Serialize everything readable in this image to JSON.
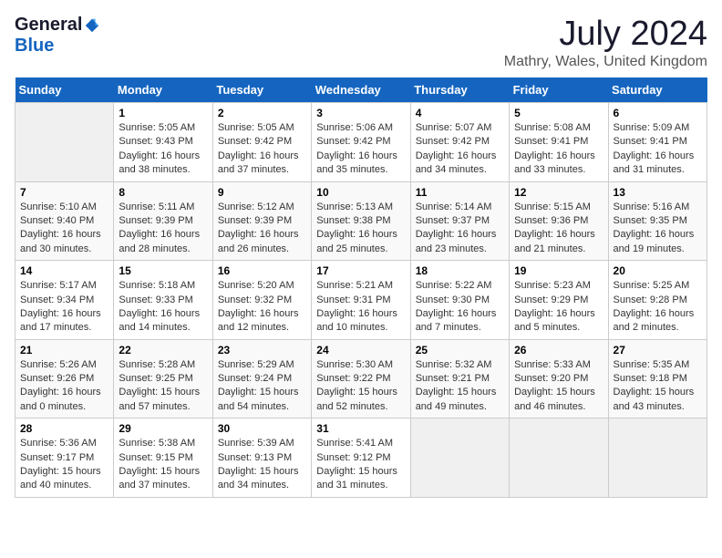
{
  "logo": {
    "general": "General",
    "blue": "Blue"
  },
  "title": "July 2024",
  "subtitle": "Mathry, Wales, United Kingdom",
  "headers": [
    "Sunday",
    "Monday",
    "Tuesday",
    "Wednesday",
    "Thursday",
    "Friday",
    "Saturday"
  ],
  "weeks": [
    [
      {
        "day": "",
        "info": ""
      },
      {
        "day": "1",
        "info": "Sunrise: 5:05 AM\nSunset: 9:43 PM\nDaylight: 16 hours\nand 38 minutes."
      },
      {
        "day": "2",
        "info": "Sunrise: 5:05 AM\nSunset: 9:42 PM\nDaylight: 16 hours\nand 37 minutes."
      },
      {
        "day": "3",
        "info": "Sunrise: 5:06 AM\nSunset: 9:42 PM\nDaylight: 16 hours\nand 35 minutes."
      },
      {
        "day": "4",
        "info": "Sunrise: 5:07 AM\nSunset: 9:42 PM\nDaylight: 16 hours\nand 34 minutes."
      },
      {
        "day": "5",
        "info": "Sunrise: 5:08 AM\nSunset: 9:41 PM\nDaylight: 16 hours\nand 33 minutes."
      },
      {
        "day": "6",
        "info": "Sunrise: 5:09 AM\nSunset: 9:41 PM\nDaylight: 16 hours\nand 31 minutes."
      }
    ],
    [
      {
        "day": "7",
        "info": "Sunrise: 5:10 AM\nSunset: 9:40 PM\nDaylight: 16 hours\nand 30 minutes."
      },
      {
        "day": "8",
        "info": "Sunrise: 5:11 AM\nSunset: 9:39 PM\nDaylight: 16 hours\nand 28 minutes."
      },
      {
        "day": "9",
        "info": "Sunrise: 5:12 AM\nSunset: 9:39 PM\nDaylight: 16 hours\nand 26 minutes."
      },
      {
        "day": "10",
        "info": "Sunrise: 5:13 AM\nSunset: 9:38 PM\nDaylight: 16 hours\nand 25 minutes."
      },
      {
        "day": "11",
        "info": "Sunrise: 5:14 AM\nSunset: 9:37 PM\nDaylight: 16 hours\nand 23 minutes."
      },
      {
        "day": "12",
        "info": "Sunrise: 5:15 AM\nSunset: 9:36 PM\nDaylight: 16 hours\nand 21 minutes."
      },
      {
        "day": "13",
        "info": "Sunrise: 5:16 AM\nSunset: 9:35 PM\nDaylight: 16 hours\nand 19 minutes."
      }
    ],
    [
      {
        "day": "14",
        "info": "Sunrise: 5:17 AM\nSunset: 9:34 PM\nDaylight: 16 hours\nand 17 minutes."
      },
      {
        "day": "15",
        "info": "Sunrise: 5:18 AM\nSunset: 9:33 PM\nDaylight: 16 hours\nand 14 minutes."
      },
      {
        "day": "16",
        "info": "Sunrise: 5:20 AM\nSunset: 9:32 PM\nDaylight: 16 hours\nand 12 minutes."
      },
      {
        "day": "17",
        "info": "Sunrise: 5:21 AM\nSunset: 9:31 PM\nDaylight: 16 hours\nand 10 minutes."
      },
      {
        "day": "18",
        "info": "Sunrise: 5:22 AM\nSunset: 9:30 PM\nDaylight: 16 hours\nand 7 minutes."
      },
      {
        "day": "19",
        "info": "Sunrise: 5:23 AM\nSunset: 9:29 PM\nDaylight: 16 hours\nand 5 minutes."
      },
      {
        "day": "20",
        "info": "Sunrise: 5:25 AM\nSunset: 9:28 PM\nDaylight: 16 hours\nand 2 minutes."
      }
    ],
    [
      {
        "day": "21",
        "info": "Sunrise: 5:26 AM\nSunset: 9:26 PM\nDaylight: 16 hours\nand 0 minutes."
      },
      {
        "day": "22",
        "info": "Sunrise: 5:28 AM\nSunset: 9:25 PM\nDaylight: 15 hours\nand 57 minutes."
      },
      {
        "day": "23",
        "info": "Sunrise: 5:29 AM\nSunset: 9:24 PM\nDaylight: 15 hours\nand 54 minutes."
      },
      {
        "day": "24",
        "info": "Sunrise: 5:30 AM\nSunset: 9:22 PM\nDaylight: 15 hours\nand 52 minutes."
      },
      {
        "day": "25",
        "info": "Sunrise: 5:32 AM\nSunset: 9:21 PM\nDaylight: 15 hours\nand 49 minutes."
      },
      {
        "day": "26",
        "info": "Sunrise: 5:33 AM\nSunset: 9:20 PM\nDaylight: 15 hours\nand 46 minutes."
      },
      {
        "day": "27",
        "info": "Sunrise: 5:35 AM\nSunset: 9:18 PM\nDaylight: 15 hours\nand 43 minutes."
      }
    ],
    [
      {
        "day": "28",
        "info": "Sunrise: 5:36 AM\nSunset: 9:17 PM\nDaylight: 15 hours\nand 40 minutes."
      },
      {
        "day": "29",
        "info": "Sunrise: 5:38 AM\nSunset: 9:15 PM\nDaylight: 15 hours\nand 37 minutes."
      },
      {
        "day": "30",
        "info": "Sunrise: 5:39 AM\nSunset: 9:13 PM\nDaylight: 15 hours\nand 34 minutes."
      },
      {
        "day": "31",
        "info": "Sunrise: 5:41 AM\nSunset: 9:12 PM\nDaylight: 15 hours\nand 31 minutes."
      },
      {
        "day": "",
        "info": ""
      },
      {
        "day": "",
        "info": ""
      },
      {
        "day": "",
        "info": ""
      }
    ]
  ]
}
